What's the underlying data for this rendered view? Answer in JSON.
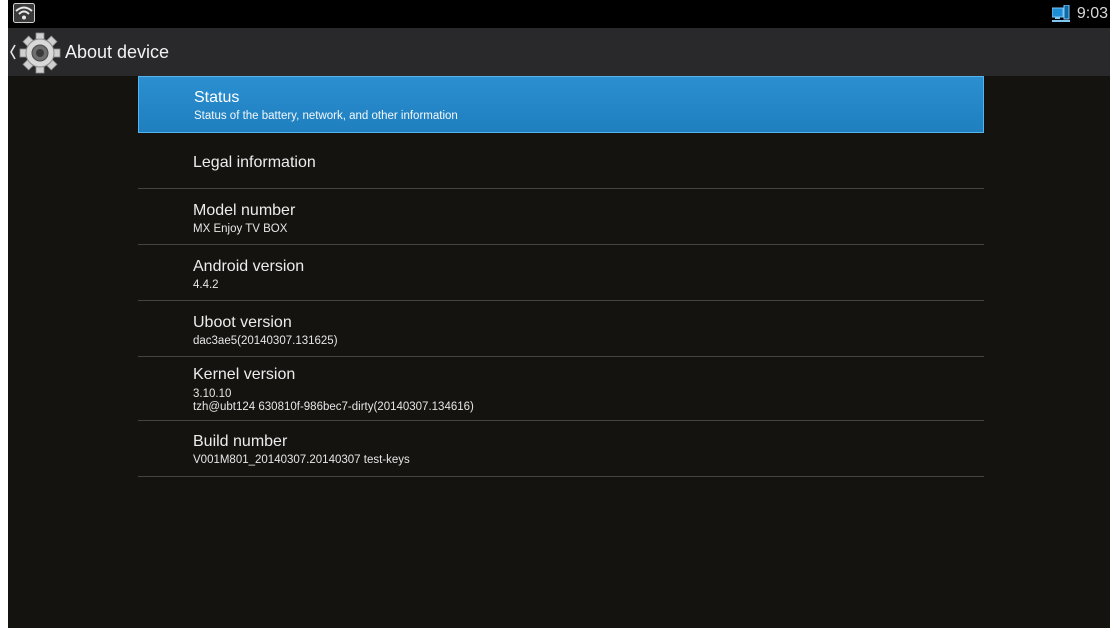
{
  "status_bar": {
    "time": "9:03",
    "wifi_icon": "wifi-icon",
    "network_icon": "network-monitor-icon"
  },
  "action_bar": {
    "title": "About device",
    "up_icon": "chevron-left-icon",
    "app_icon": "gear-icon"
  },
  "colors": {
    "background": "#141310",
    "action_bar": "#29292b",
    "selected": "#2286c8",
    "divider": "#45443f"
  },
  "items": [
    {
      "title": "Status",
      "summary": "Status of the battery, network, and other information",
      "selected": true
    },
    {
      "title": "Legal information"
    },
    {
      "title": "Model number",
      "summary": "MX Enjoy TV BOX"
    },
    {
      "title": "Android version",
      "summary": "4.4.2"
    },
    {
      "title": "Uboot version",
      "summary": "dac3ae5(20140307.131625)"
    },
    {
      "title": "Kernel version",
      "summary_lines": [
        "3.10.10",
        "tzh@ubt124 630810f-986bec7-dirty(20140307.134616)"
      ]
    },
    {
      "title": "Build number",
      "summary": "V001M801_20140307.20140307 test-keys"
    }
  ]
}
